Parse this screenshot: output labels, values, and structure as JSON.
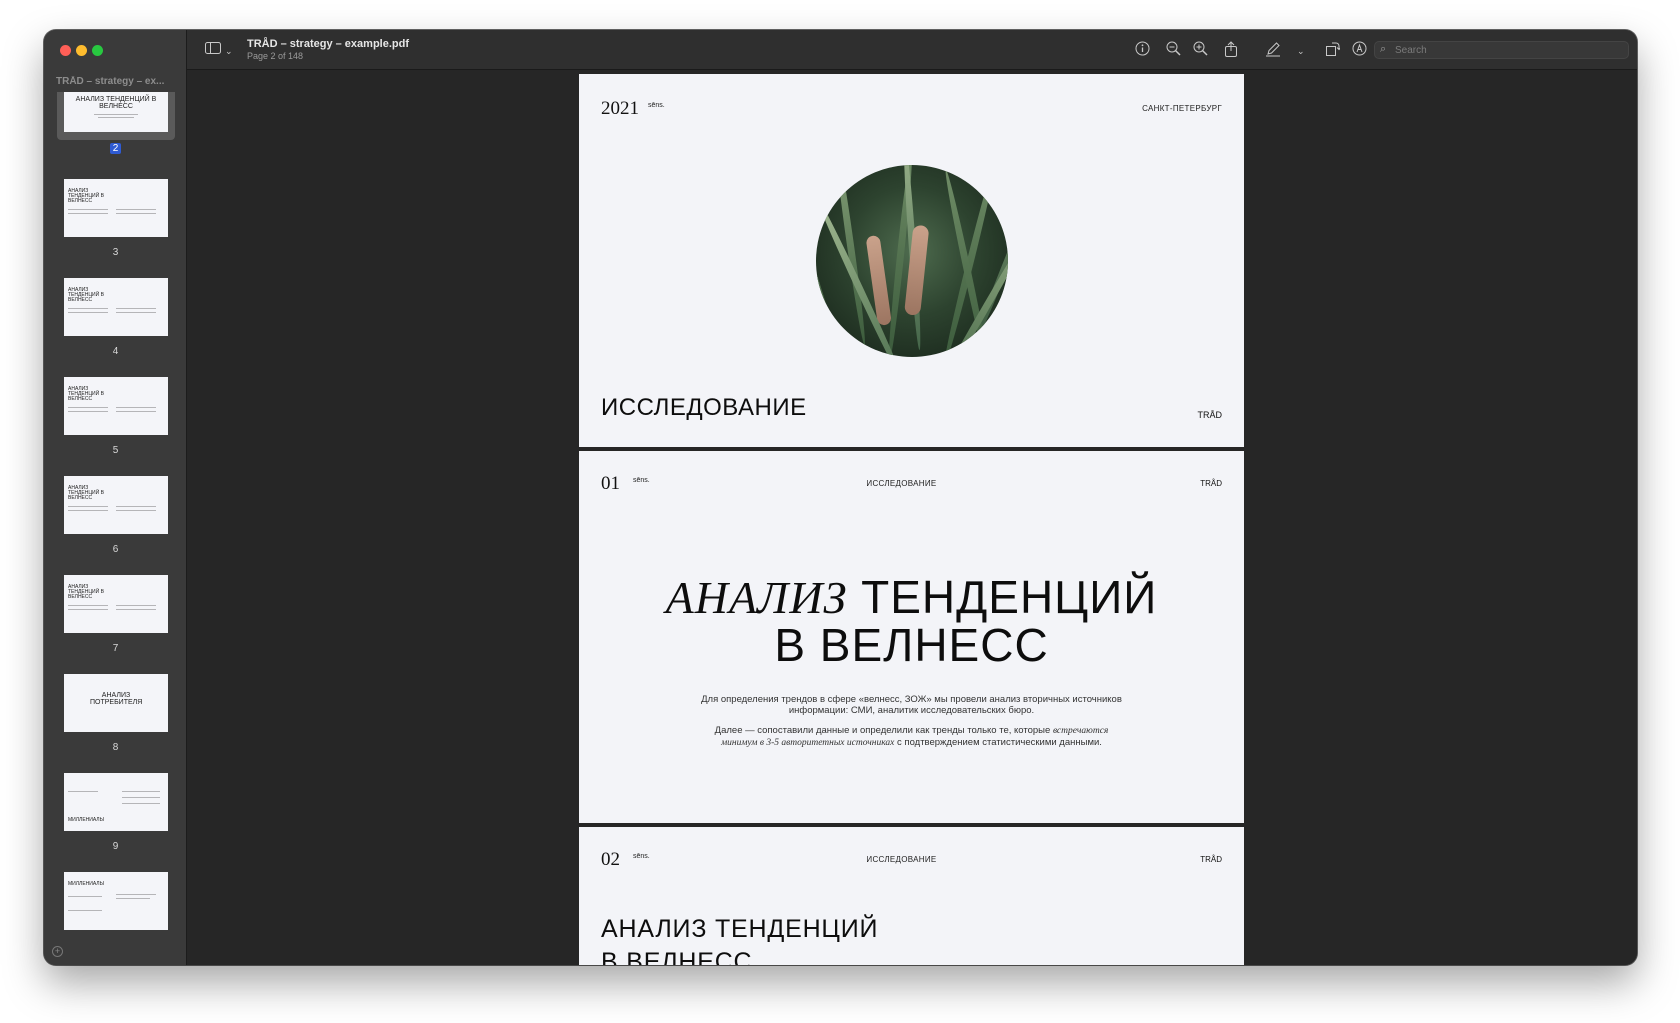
{
  "window": {
    "title": "TRÅD – strategy – example.pdf",
    "subtitle": "Page 2 of 148",
    "sidebar_caption": "TRÅD – strategy – ex..."
  },
  "toolbar": {
    "search_placeholder": "Search",
    "icons": [
      "sidebar-toggle-icon",
      "chevron-down-icon",
      "info-icon",
      "zoom-out-icon",
      "zoom-in-icon",
      "share-icon",
      "markup-pen-icon",
      "chevron-down-icon",
      "rotate-icon",
      "annotate-icon",
      "signature-icon",
      "search-icon"
    ]
  },
  "thumbnails": [
    {
      "num": "2",
      "title": "АНАЛИЗ ТЕНДЕНЦИЙ В ВЕЛНЕСС",
      "selected": true
    },
    {
      "num": "3",
      "title": "АНАЛИЗ ТЕНДЕНЦИЙ В ВЕЛНЕСС"
    },
    {
      "num": "4",
      "title": "АНАЛИЗ ТЕНДЕНЦИЙ В ВЕЛНЕСС"
    },
    {
      "num": "5",
      "title": "АНАЛИЗ ТЕНДЕНЦИЙ В ВЕЛНЕСС"
    },
    {
      "num": "6",
      "title": "АНАЛИЗ ТЕНДЕНЦИЙ В ВЕЛНЕСС"
    },
    {
      "num": "7",
      "title": "АНАЛИЗ ТЕНДЕНЦИЙ В ВЕЛНЕСС"
    },
    {
      "num": "8",
      "title": "АНАЛИЗ ПОТРЕБИТЕЛЯ"
    },
    {
      "num": "9",
      "title": "МИЛЛЕНИАЛЫ"
    },
    {
      "num": "",
      "title": "МИЛЛЕНИАЛЫ"
    }
  ],
  "page1": {
    "year": "2021",
    "sens": "sēns.",
    "city": "САНКТ-ПЕТЕРБУРГ",
    "heading": "ИССЛЕДОВАНИЕ",
    "brand": "TRÅD"
  },
  "page2": {
    "num": "01",
    "sens": "sēns.",
    "section": "ИССЛЕДОВАНИЕ",
    "brand": "TRÅD",
    "title_italic": "АНАЛИЗ",
    "title_rest": "ТЕНДЕНЦИЙ",
    "title_line2": "В ВЕЛНЕСС",
    "para1": "Для определения трендов в сфере «велнесс, ЗОЖ» мы провели анализ вторичных источников информации: СМИ, аналитик исследовательских бюро.",
    "para2_a": "Далее — сопоставили данные и определили как тренды только те, которые",
    "para2_italic": "встречаются минимум в 3-5 авторитетных источниках",
    "para2_b": "с подтверждением статистическими данными."
  },
  "page3": {
    "num": "02",
    "sens": "sēns.",
    "section": "ИССЛЕДОВАНИЕ",
    "brand": "TRÅD",
    "heading_line1": "АНАЛИЗ ТЕНДЕНЦИЙ",
    "heading_line2": "В ВЕЛНЕСС"
  }
}
